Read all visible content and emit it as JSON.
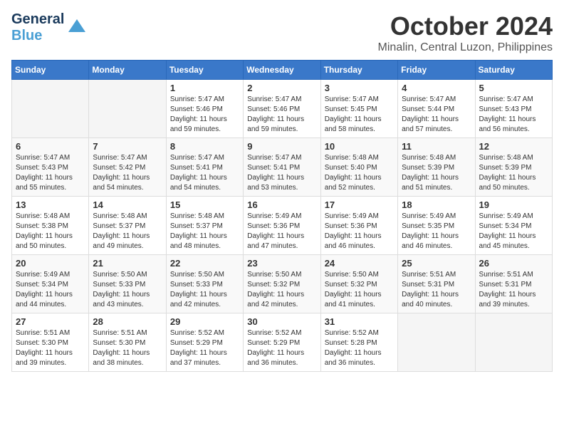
{
  "logo": {
    "line1": "General",
    "line2": "Blue",
    "tagline": ""
  },
  "title": "October 2024",
  "location": "Minalin, Central Luzon, Philippines",
  "weekdays": [
    "Sunday",
    "Monday",
    "Tuesday",
    "Wednesday",
    "Thursday",
    "Friday",
    "Saturday"
  ],
  "weeks": [
    [
      {
        "day": "",
        "empty": true
      },
      {
        "day": "",
        "empty": true
      },
      {
        "day": "1",
        "sunrise": "Sunrise: 5:47 AM",
        "sunset": "Sunset: 5:46 PM",
        "daylight": "Daylight: 11 hours and 59 minutes."
      },
      {
        "day": "2",
        "sunrise": "Sunrise: 5:47 AM",
        "sunset": "Sunset: 5:46 PM",
        "daylight": "Daylight: 11 hours and 59 minutes."
      },
      {
        "day": "3",
        "sunrise": "Sunrise: 5:47 AM",
        "sunset": "Sunset: 5:45 PM",
        "daylight": "Daylight: 11 hours and 58 minutes."
      },
      {
        "day": "4",
        "sunrise": "Sunrise: 5:47 AM",
        "sunset": "Sunset: 5:44 PM",
        "daylight": "Daylight: 11 hours and 57 minutes."
      },
      {
        "day": "5",
        "sunrise": "Sunrise: 5:47 AM",
        "sunset": "Sunset: 5:43 PM",
        "daylight": "Daylight: 11 hours and 56 minutes."
      }
    ],
    [
      {
        "day": "6",
        "sunrise": "Sunrise: 5:47 AM",
        "sunset": "Sunset: 5:43 PM",
        "daylight": "Daylight: 11 hours and 55 minutes."
      },
      {
        "day": "7",
        "sunrise": "Sunrise: 5:47 AM",
        "sunset": "Sunset: 5:42 PM",
        "daylight": "Daylight: 11 hours and 54 minutes."
      },
      {
        "day": "8",
        "sunrise": "Sunrise: 5:47 AM",
        "sunset": "Sunset: 5:41 PM",
        "daylight": "Daylight: 11 hours and 54 minutes."
      },
      {
        "day": "9",
        "sunrise": "Sunrise: 5:47 AM",
        "sunset": "Sunset: 5:41 PM",
        "daylight": "Daylight: 11 hours and 53 minutes."
      },
      {
        "day": "10",
        "sunrise": "Sunrise: 5:48 AM",
        "sunset": "Sunset: 5:40 PM",
        "daylight": "Daylight: 11 hours and 52 minutes."
      },
      {
        "day": "11",
        "sunrise": "Sunrise: 5:48 AM",
        "sunset": "Sunset: 5:39 PM",
        "daylight": "Daylight: 11 hours and 51 minutes."
      },
      {
        "day": "12",
        "sunrise": "Sunrise: 5:48 AM",
        "sunset": "Sunset: 5:39 PM",
        "daylight": "Daylight: 11 hours and 50 minutes."
      }
    ],
    [
      {
        "day": "13",
        "sunrise": "Sunrise: 5:48 AM",
        "sunset": "Sunset: 5:38 PM",
        "daylight": "Daylight: 11 hours and 50 minutes."
      },
      {
        "day": "14",
        "sunrise": "Sunrise: 5:48 AM",
        "sunset": "Sunset: 5:37 PM",
        "daylight": "Daylight: 11 hours and 49 minutes."
      },
      {
        "day": "15",
        "sunrise": "Sunrise: 5:48 AM",
        "sunset": "Sunset: 5:37 PM",
        "daylight": "Daylight: 11 hours and 48 minutes."
      },
      {
        "day": "16",
        "sunrise": "Sunrise: 5:49 AM",
        "sunset": "Sunset: 5:36 PM",
        "daylight": "Daylight: 11 hours and 47 minutes."
      },
      {
        "day": "17",
        "sunrise": "Sunrise: 5:49 AM",
        "sunset": "Sunset: 5:36 PM",
        "daylight": "Daylight: 11 hours and 46 minutes."
      },
      {
        "day": "18",
        "sunrise": "Sunrise: 5:49 AM",
        "sunset": "Sunset: 5:35 PM",
        "daylight": "Daylight: 11 hours and 46 minutes."
      },
      {
        "day": "19",
        "sunrise": "Sunrise: 5:49 AM",
        "sunset": "Sunset: 5:34 PM",
        "daylight": "Daylight: 11 hours and 45 minutes."
      }
    ],
    [
      {
        "day": "20",
        "sunrise": "Sunrise: 5:49 AM",
        "sunset": "Sunset: 5:34 PM",
        "daylight": "Daylight: 11 hours and 44 minutes."
      },
      {
        "day": "21",
        "sunrise": "Sunrise: 5:50 AM",
        "sunset": "Sunset: 5:33 PM",
        "daylight": "Daylight: 11 hours and 43 minutes."
      },
      {
        "day": "22",
        "sunrise": "Sunrise: 5:50 AM",
        "sunset": "Sunset: 5:33 PM",
        "daylight": "Daylight: 11 hours and 42 minutes."
      },
      {
        "day": "23",
        "sunrise": "Sunrise: 5:50 AM",
        "sunset": "Sunset: 5:32 PM",
        "daylight": "Daylight: 11 hours and 42 minutes."
      },
      {
        "day": "24",
        "sunrise": "Sunrise: 5:50 AM",
        "sunset": "Sunset: 5:32 PM",
        "daylight": "Daylight: 11 hours and 41 minutes."
      },
      {
        "day": "25",
        "sunrise": "Sunrise: 5:51 AM",
        "sunset": "Sunset: 5:31 PM",
        "daylight": "Daylight: 11 hours and 40 minutes."
      },
      {
        "day": "26",
        "sunrise": "Sunrise: 5:51 AM",
        "sunset": "Sunset: 5:31 PM",
        "daylight": "Daylight: 11 hours and 39 minutes."
      }
    ],
    [
      {
        "day": "27",
        "sunrise": "Sunrise: 5:51 AM",
        "sunset": "Sunset: 5:30 PM",
        "daylight": "Daylight: 11 hours and 39 minutes."
      },
      {
        "day": "28",
        "sunrise": "Sunrise: 5:51 AM",
        "sunset": "Sunset: 5:30 PM",
        "daylight": "Daylight: 11 hours and 38 minutes."
      },
      {
        "day": "29",
        "sunrise": "Sunrise: 5:52 AM",
        "sunset": "Sunset: 5:29 PM",
        "daylight": "Daylight: 11 hours and 37 minutes."
      },
      {
        "day": "30",
        "sunrise": "Sunrise: 5:52 AM",
        "sunset": "Sunset: 5:29 PM",
        "daylight": "Daylight: 11 hours and 36 minutes."
      },
      {
        "day": "31",
        "sunrise": "Sunrise: 5:52 AM",
        "sunset": "Sunset: 5:28 PM",
        "daylight": "Daylight: 11 hours and 36 minutes."
      },
      {
        "day": "",
        "empty": true
      },
      {
        "day": "",
        "empty": true
      }
    ]
  ]
}
